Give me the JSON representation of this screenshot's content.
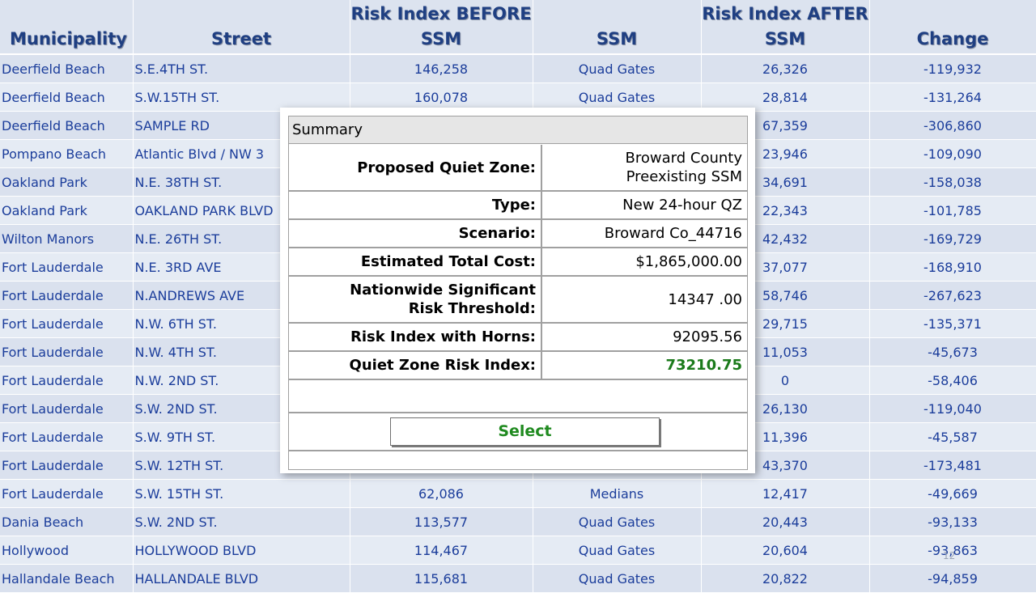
{
  "table": {
    "headers": {
      "municipality": "Municipality",
      "street": "Street",
      "before_line1": "Risk Index BEFORE",
      "before_line2": "SSM",
      "ssm": "SSM",
      "after_line1": "Risk Index AFTER",
      "after_line2": "SSM",
      "change": "Change"
    },
    "rows": [
      {
        "municipality": "Deerfield Beach",
        "street": "S.E.4TH ST.",
        "before": "146,258",
        "ssm": "Quad Gates",
        "after": "26,326",
        "change": "-119,932"
      },
      {
        "municipality": "Deerfield Beach",
        "street": "S.W.15TH ST.",
        "before": "160,078",
        "ssm": "Quad Gates",
        "after": "28,814",
        "change": "-131,264"
      },
      {
        "municipality": "Deerfield Beach",
        "street": "SAMPLE RD",
        "before": "",
        "ssm": "",
        "after": "67,359",
        "change": "-306,860"
      },
      {
        "municipality": "Pompano Beach",
        "street": "Atlantic Blvd / NW 3",
        "before": "",
        "ssm": "",
        "after": "23,946",
        "change": "-109,090"
      },
      {
        "municipality": "Oakland Park",
        "street": "N.E. 38TH ST.",
        "before": "",
        "ssm": "",
        "after": "34,691",
        "change": "-158,038"
      },
      {
        "municipality": "Oakland Park",
        "street": "OAKLAND PARK BLVD",
        "before": "",
        "ssm": "",
        "after": "22,343",
        "change": "-101,785"
      },
      {
        "municipality": "Wilton Manors",
        "street": "N.E. 26TH ST.",
        "before": "",
        "ssm": "",
        "after": "42,432",
        "change": "-169,729"
      },
      {
        "municipality": "Fort Lauderdale",
        "street": "N.E. 3RD AVE",
        "before": "",
        "ssm": "",
        "after": "37,077",
        "change": "-168,910"
      },
      {
        "municipality": "Fort Lauderdale",
        "street": "N.ANDREWS AVE",
        "before": "",
        "ssm": "",
        "after": "58,746",
        "change": "-267,623"
      },
      {
        "municipality": "Fort Lauderdale",
        "street": "N.W. 6TH ST.",
        "before": "",
        "ssm": "",
        "after": "29,715",
        "change": "-135,371"
      },
      {
        "municipality": "Fort Lauderdale",
        "street": "N.W. 4TH ST.",
        "before": "",
        "ssm": "",
        "after": "11,053",
        "change": "-45,673"
      },
      {
        "municipality": "Fort Lauderdale",
        "street": "N.W. 2ND ST.",
        "before": "",
        "ssm": "",
        "after": "0",
        "change": "-58,406"
      },
      {
        "municipality": "Fort Lauderdale",
        "street": "S.W. 2ND ST.",
        "before": "",
        "ssm": "",
        "after": "26,130",
        "change": "-119,040"
      },
      {
        "municipality": "Fort Lauderdale",
        "street": "S.W. 9TH ST.",
        "before": "",
        "ssm": "",
        "after": "11,396",
        "change": "-45,587"
      },
      {
        "municipality": "Fort Lauderdale",
        "street": "S.W. 12TH ST.",
        "before": "",
        "ssm": "",
        "after": "43,370",
        "change": "-173,481"
      },
      {
        "municipality": "Fort Lauderdale",
        "street": "S.W. 15TH ST.",
        "before": "62,086",
        "ssm": "Medians",
        "after": "12,417",
        "change": "-49,669"
      },
      {
        "municipality": "Dania Beach",
        "street": "S.W. 2ND ST.",
        "before": "113,577",
        "ssm": "Quad Gates",
        "after": "20,443",
        "change": "-93,133"
      },
      {
        "municipality": "Hollywood",
        "street": "HOLLYWOOD BLVD",
        "before": "114,467",
        "ssm": "Quad Gates",
        "after": "20,604",
        "change": "-93,863"
      },
      {
        "municipality": "Hallandale Beach",
        "street": "HALLANDALE BLVD",
        "before": "115,681",
        "ssm": "Quad Gates",
        "after": "20,822",
        "change": "-94,859"
      }
    ]
  },
  "summary": {
    "title": "Summary",
    "rows": [
      {
        "label": "Proposed Quiet Zone:",
        "value_line1": "Broward County",
        "value_line2": "Preexisting SSM"
      },
      {
        "label": "Type:",
        "value": "New 24-hour QZ"
      },
      {
        "label": "Scenario:",
        "value": "Broward Co_44716"
      },
      {
        "label": "Estimated Total Cost:",
        "value": "$1,865,000.00"
      },
      {
        "label_line1": "Nationwide Significant",
        "label_line2": "Risk Threshold:",
        "value": "14347 .00"
      },
      {
        "label": "Risk Index with Horns:",
        "value": "92095.56"
      },
      {
        "label": "Quiet Zone Risk Index:",
        "value": "73210.75"
      }
    ],
    "select_label": "Select"
  },
  "page_number": "12",
  "colors": {
    "header_text": "#1f3f82",
    "cell_text": "#1b3d9b",
    "highlight_value": "#1a7a1a"
  }
}
